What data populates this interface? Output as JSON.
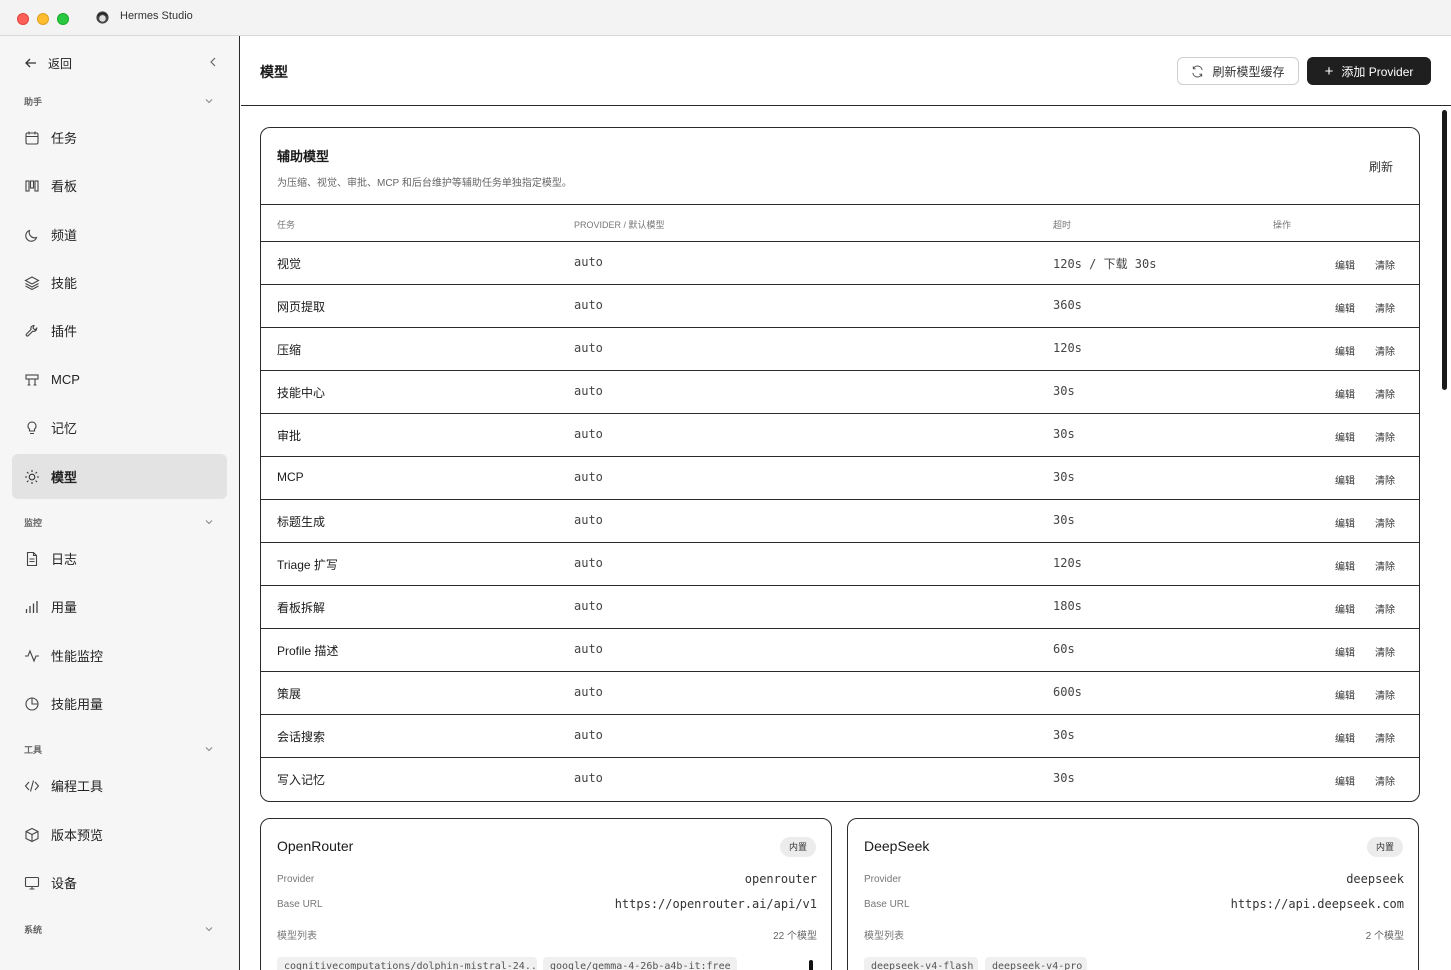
{
  "window": {
    "title": "Hermes Studio"
  },
  "sidebar": {
    "back_label": "返回",
    "sections": {
      "assistant": "助手",
      "monitor": "监控",
      "tools": "工具",
      "system": "系统"
    },
    "items": [
      {
        "label": "任务",
        "icon": "calendar-icon"
      },
      {
        "label": "看板",
        "icon": "board-icon"
      },
      {
        "label": "频道",
        "icon": "moon-icon"
      },
      {
        "label": "技能",
        "icon": "layers-icon"
      },
      {
        "label": "插件",
        "icon": "wrench-icon"
      },
      {
        "label": "MCP",
        "icon": "mcp-icon"
      },
      {
        "label": "记忆",
        "icon": "lightbulb-icon"
      },
      {
        "label": "模型",
        "icon": "sun-icon",
        "active": true
      },
      {
        "label": "日志",
        "icon": "document-icon"
      },
      {
        "label": "用量",
        "icon": "bar-chart-icon"
      },
      {
        "label": "性能监控",
        "icon": "activity-icon"
      },
      {
        "label": "技能用量",
        "icon": "pie-clock-icon"
      },
      {
        "label": "编程工具",
        "icon": "code-icon"
      },
      {
        "label": "版本预览",
        "icon": "package-icon"
      },
      {
        "label": "设备",
        "icon": "monitor-icon"
      }
    ]
  },
  "header": {
    "title": "模型",
    "refresh_cache_label": "刷新模型缓存",
    "add_provider_label": "添加 Provider"
  },
  "aux": {
    "title": "辅助模型",
    "description": "为压缩、视觉、审批、MCP 和后台维护等辅助任务单独指定模型。",
    "refresh_label": "刷新",
    "columns": {
      "task": "任务",
      "provider": "PROVIDER / 默认模型",
      "timeout": "超时",
      "ops": "操作"
    },
    "edit_label": "编辑",
    "clear_label": "清除",
    "rows": [
      {
        "task": "视觉",
        "provider": "auto",
        "timeout": "120s / 下载 30s"
      },
      {
        "task": "网页提取",
        "provider": "auto",
        "timeout": "360s"
      },
      {
        "task": "压缩",
        "provider": "auto",
        "timeout": "120s"
      },
      {
        "task": "技能中心",
        "provider": "auto",
        "timeout": "30s"
      },
      {
        "task": "审批",
        "provider": "auto",
        "timeout": "30s"
      },
      {
        "task": "MCP",
        "provider": "auto",
        "timeout": "30s"
      },
      {
        "task": "标题生成",
        "provider": "auto",
        "timeout": "30s"
      },
      {
        "task": "Triage 扩写",
        "provider": "auto",
        "timeout": "120s"
      },
      {
        "task": "看板拆解",
        "provider": "auto",
        "timeout": "180s"
      },
      {
        "task": "Profile 描述",
        "provider": "auto",
        "timeout": "60s"
      },
      {
        "task": "策展",
        "provider": "auto",
        "timeout": "600s"
      },
      {
        "task": "会话搜索",
        "provider": "auto",
        "timeout": "30s"
      },
      {
        "task": "写入记忆",
        "provider": "auto",
        "timeout": "30s"
      }
    ]
  },
  "providers": [
    {
      "name": "OpenRouter",
      "badge": "内置",
      "provider_label": "Provider",
      "provider_value": "openrouter",
      "base_url_label": "Base URL",
      "base_url_value": "https://openrouter.ai/api/v1",
      "models_label": "模型列表",
      "models_count": "22 个模型",
      "chips": [
        "cognitivecomputations/dolphin-mistral-24...",
        "google/gemma-4-26b-a4b-it:free"
      ]
    },
    {
      "name": "DeepSeek",
      "badge": "内置",
      "provider_label": "Provider",
      "provider_value": "deepseek",
      "base_url_label": "Base URL",
      "base_url_value": "https://api.deepseek.com",
      "models_label": "模型列表",
      "models_count": "2 个模型",
      "chips": [
        "deepseek-v4-flash",
        "deepseek-v4-pro"
      ]
    }
  ]
}
